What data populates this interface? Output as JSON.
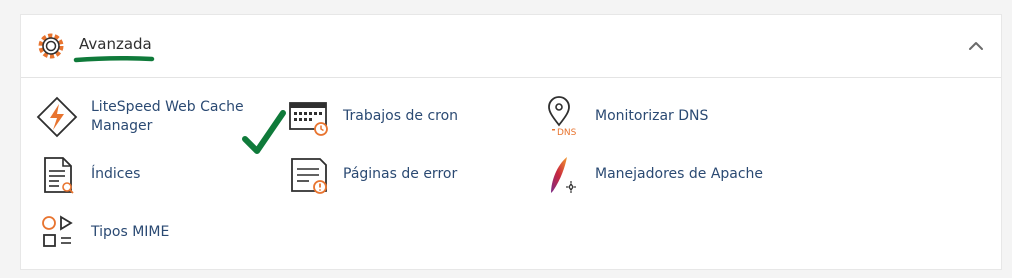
{
  "section": {
    "title": "Avanzada",
    "items": [
      {
        "label_line1": "LiteSpeed Web Cache",
        "label_line2": "Manager"
      },
      {
        "label": "Trabajos de cron"
      },
      {
        "label": "Monitorizar DNS",
        "icon_text": "DNS"
      },
      {
        "label": "Índices"
      },
      {
        "label": "Páginas de error"
      },
      {
        "label": "Manejadores de Apache"
      },
      {
        "label": "Tipos MIME"
      }
    ]
  },
  "colors": {
    "accent_orange": "#e8742f",
    "annotation_green": "#0f7a3a",
    "link_blue": "#2b4a73",
    "icon_dark": "#2f2f2f"
  }
}
